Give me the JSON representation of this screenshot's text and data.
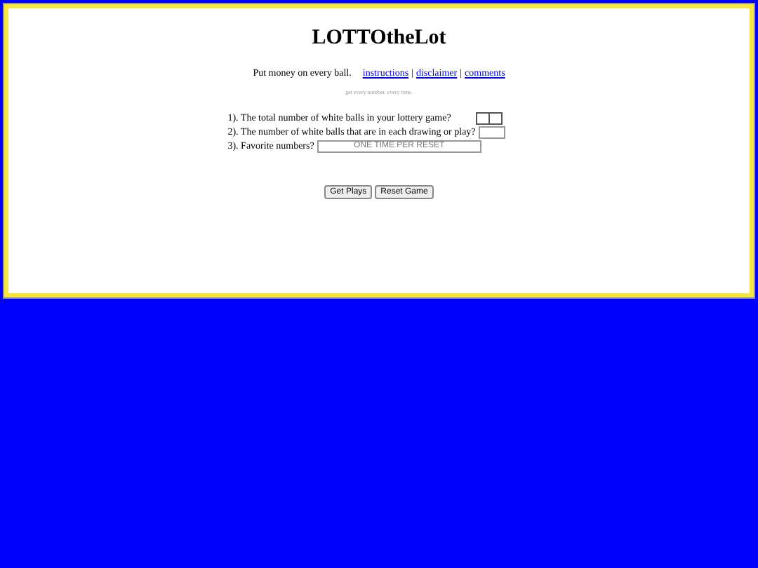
{
  "title": "LOTTOtheLot",
  "tagline": "Put money on every ball.",
  "links": [
    {
      "kind": "link",
      "label": "instructions"
    },
    {
      "kind": "separator",
      "label": "|"
    },
    {
      "kind": "link",
      "label": "disclaimer"
    },
    {
      "kind": "separator",
      "label": "|"
    },
    {
      "kind": "link",
      "label": "comments"
    }
  ],
  "subtitle": "get every number. every time.",
  "questions": [
    {
      "label": "1). The total number of white balls in your lottery game?",
      "kind": "select"
    },
    {
      "label": "2). The number of white balls that are in each drawing or play?",
      "kind": "input"
    },
    {
      "label": "3). Favorite numbers?",
      "kind": "wide",
      "placeholder": "ONE TIME PER RESET"
    }
  ],
  "buttons": [
    "Get Plays",
    "Reset Game"
  ]
}
